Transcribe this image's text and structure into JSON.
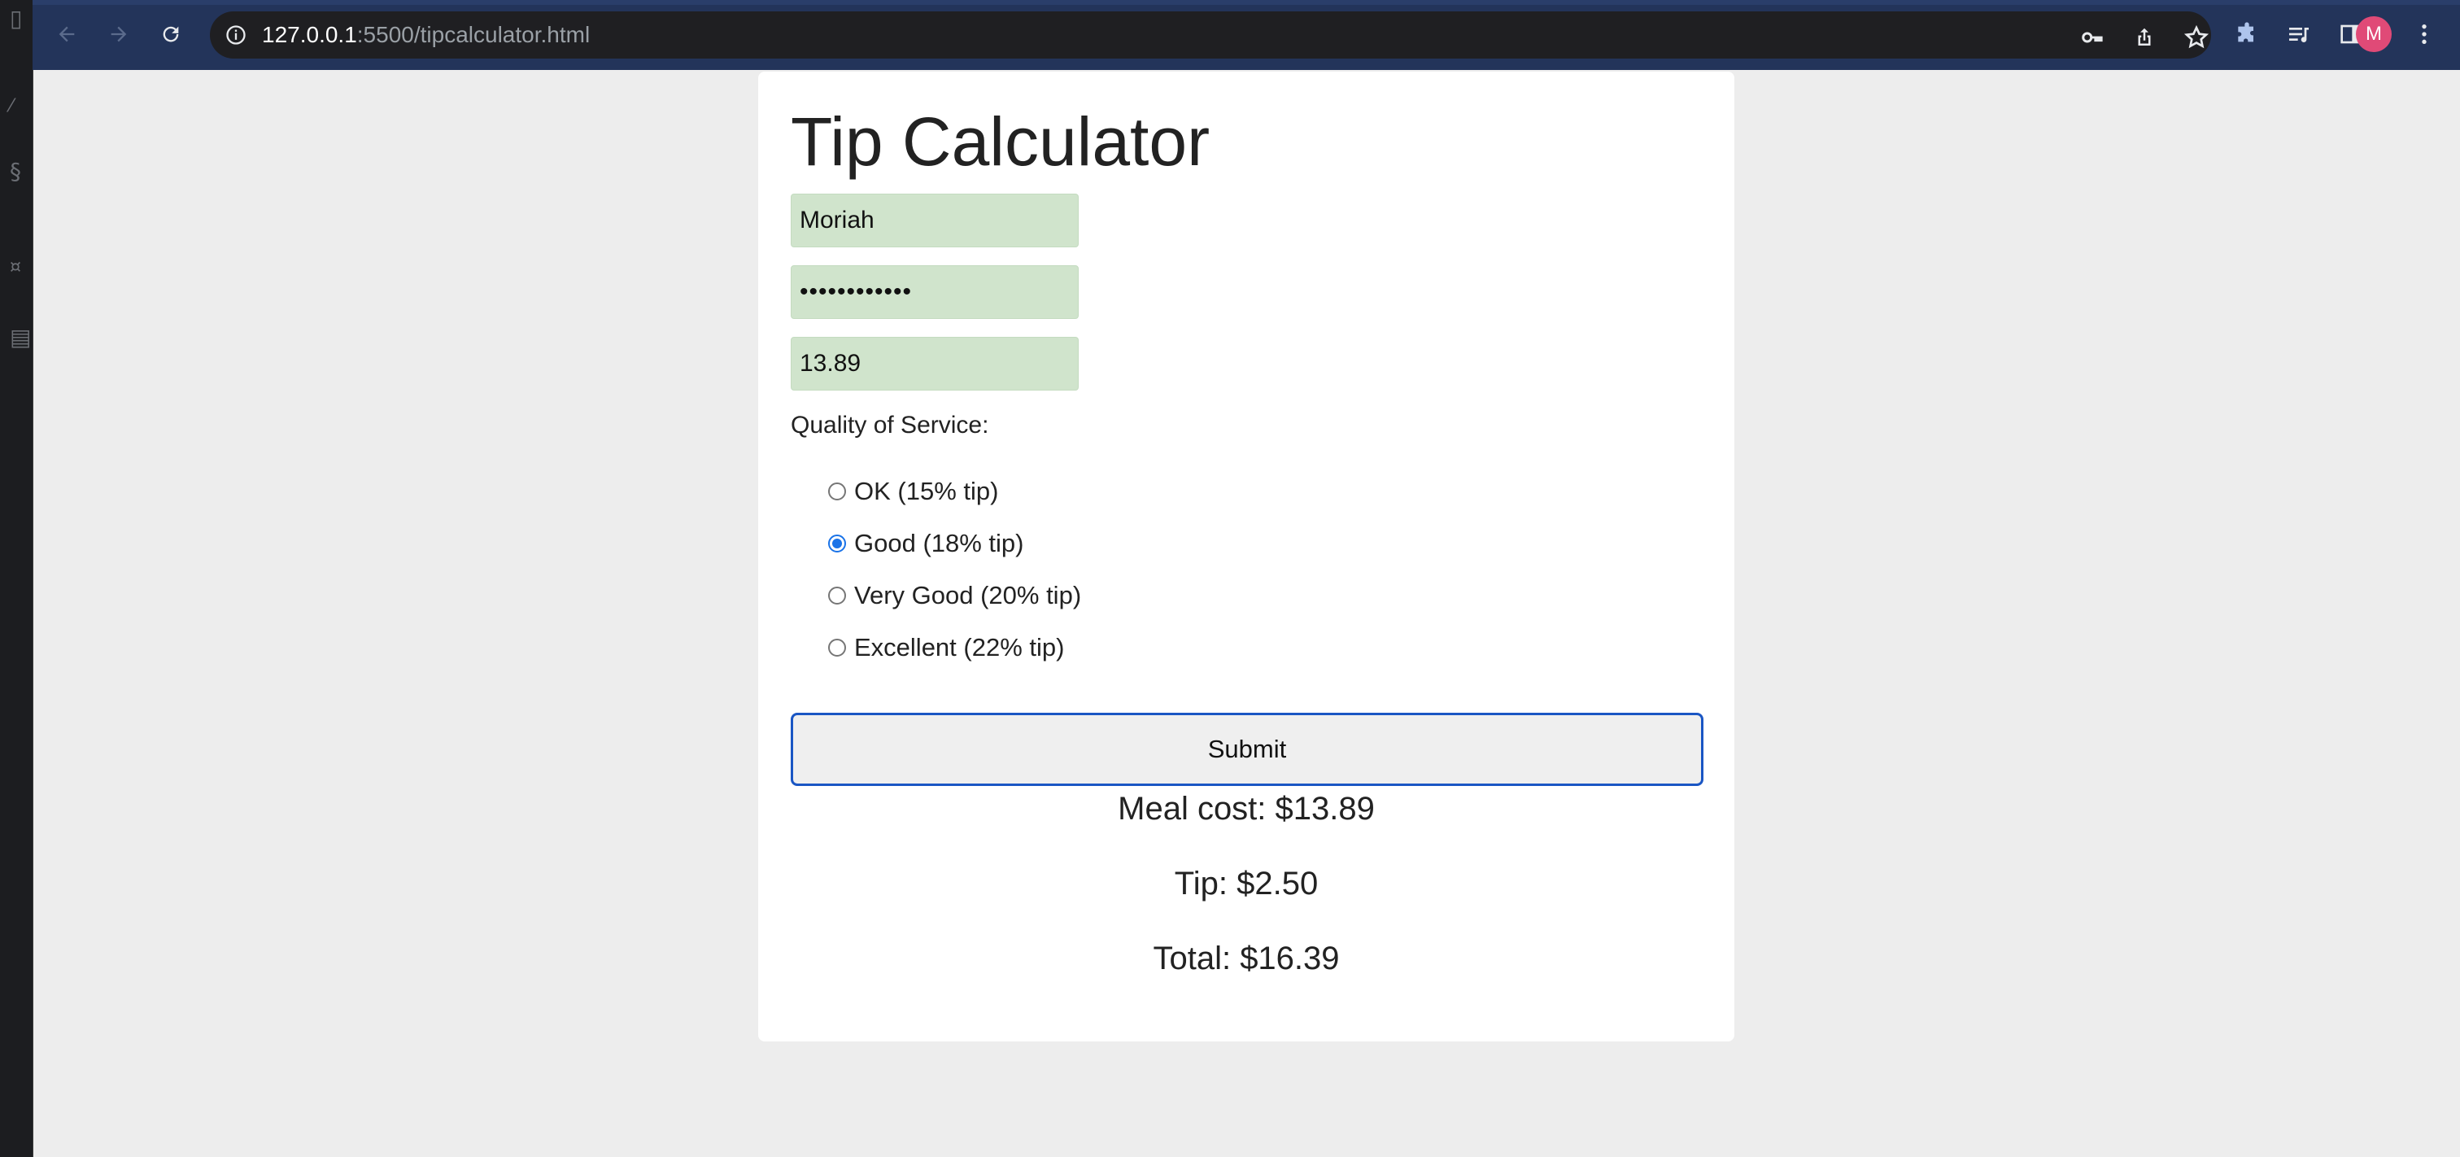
{
  "browser": {
    "url_host": "127.0.0.1",
    "url_path": ":5500/tipcalculator.html",
    "profile_initial": "M",
    "icons": [
      "back-icon",
      "forward-icon",
      "reload-icon",
      "info-icon",
      "key-icon",
      "share-icon",
      "star-icon",
      "extensions-icon",
      "reading-list-icon",
      "side-panel-icon",
      "menu-icon"
    ]
  },
  "page": {
    "title": "Tip Calculator",
    "name_value": "Moriah",
    "password_value": "••••••••••••",
    "meal_cost_value": "13.89",
    "service_label": "Quality of Service:",
    "options": [
      {
        "label": "OK (15% tip)",
        "checked": false
      },
      {
        "label": "Good (18% tip)",
        "checked": true
      },
      {
        "label": "Very Good (20% tip)",
        "checked": false
      },
      {
        "label": "Excellent (22% tip)",
        "checked": false
      }
    ],
    "submit_label": "Submit",
    "meal_cost_result": "Meal cost: $13.89",
    "tip_result": "Tip: $2.50",
    "total_result": "Total: $16.39"
  },
  "colors": {
    "chrome_bg": "#23345a",
    "field_bg": "#d0e4cc",
    "accent": "#1a73e8",
    "avatar_bg": "#e04a77"
  }
}
